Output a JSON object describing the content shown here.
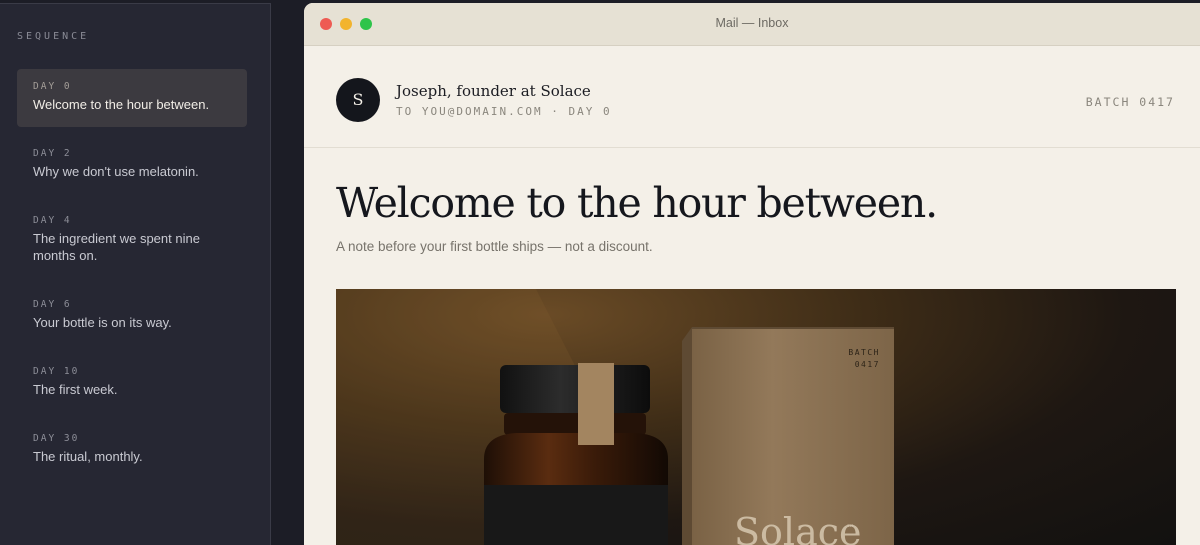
{
  "sidebar": {
    "heading": "SEQUENCE",
    "items": [
      {
        "day": "DAY 0",
        "title": "Welcome to the hour between.",
        "active": true
      },
      {
        "day": "DAY 2",
        "title": "Why we don't use melatonin."
      },
      {
        "day": "DAY 4",
        "title": "The ingredient we spent nine months on."
      },
      {
        "day": "DAY 6",
        "title": "Your bottle is on its way."
      },
      {
        "day": "DAY 10",
        "title": "The first week."
      },
      {
        "day": "DAY 30",
        "title": "The ritual, monthly."
      }
    ]
  },
  "window": {
    "title": "Mail — Inbox",
    "controls": [
      "close-icon",
      "minimize-icon",
      "zoom-icon"
    ]
  },
  "email": {
    "avatar_initial": "S",
    "sender": "Joseph, founder at Solace",
    "meta": "TO YOU@DOMAIN.COM · DAY 0",
    "batch": "BATCH 0417",
    "headline": "Welcome to the hour between.",
    "subline": "A note before your first bottle ships — not a discount.",
    "hero": {
      "box_label_line1": "BATCH",
      "box_label_line2": "0417",
      "brand": "Solace",
      "trademark": "™"
    }
  },
  "colors": {
    "sidebar_bg": "#262733",
    "active_item_bg": "#3c3a40",
    "window_bg": "#f4f0e8",
    "titlebar_bg": "#e6e1d4",
    "avatar_bg": "#14161c",
    "kraft_box": "#8f7554",
    "close": "#ee5b53",
    "minimize": "#f2b42e",
    "zoom": "#2ec44a"
  }
}
